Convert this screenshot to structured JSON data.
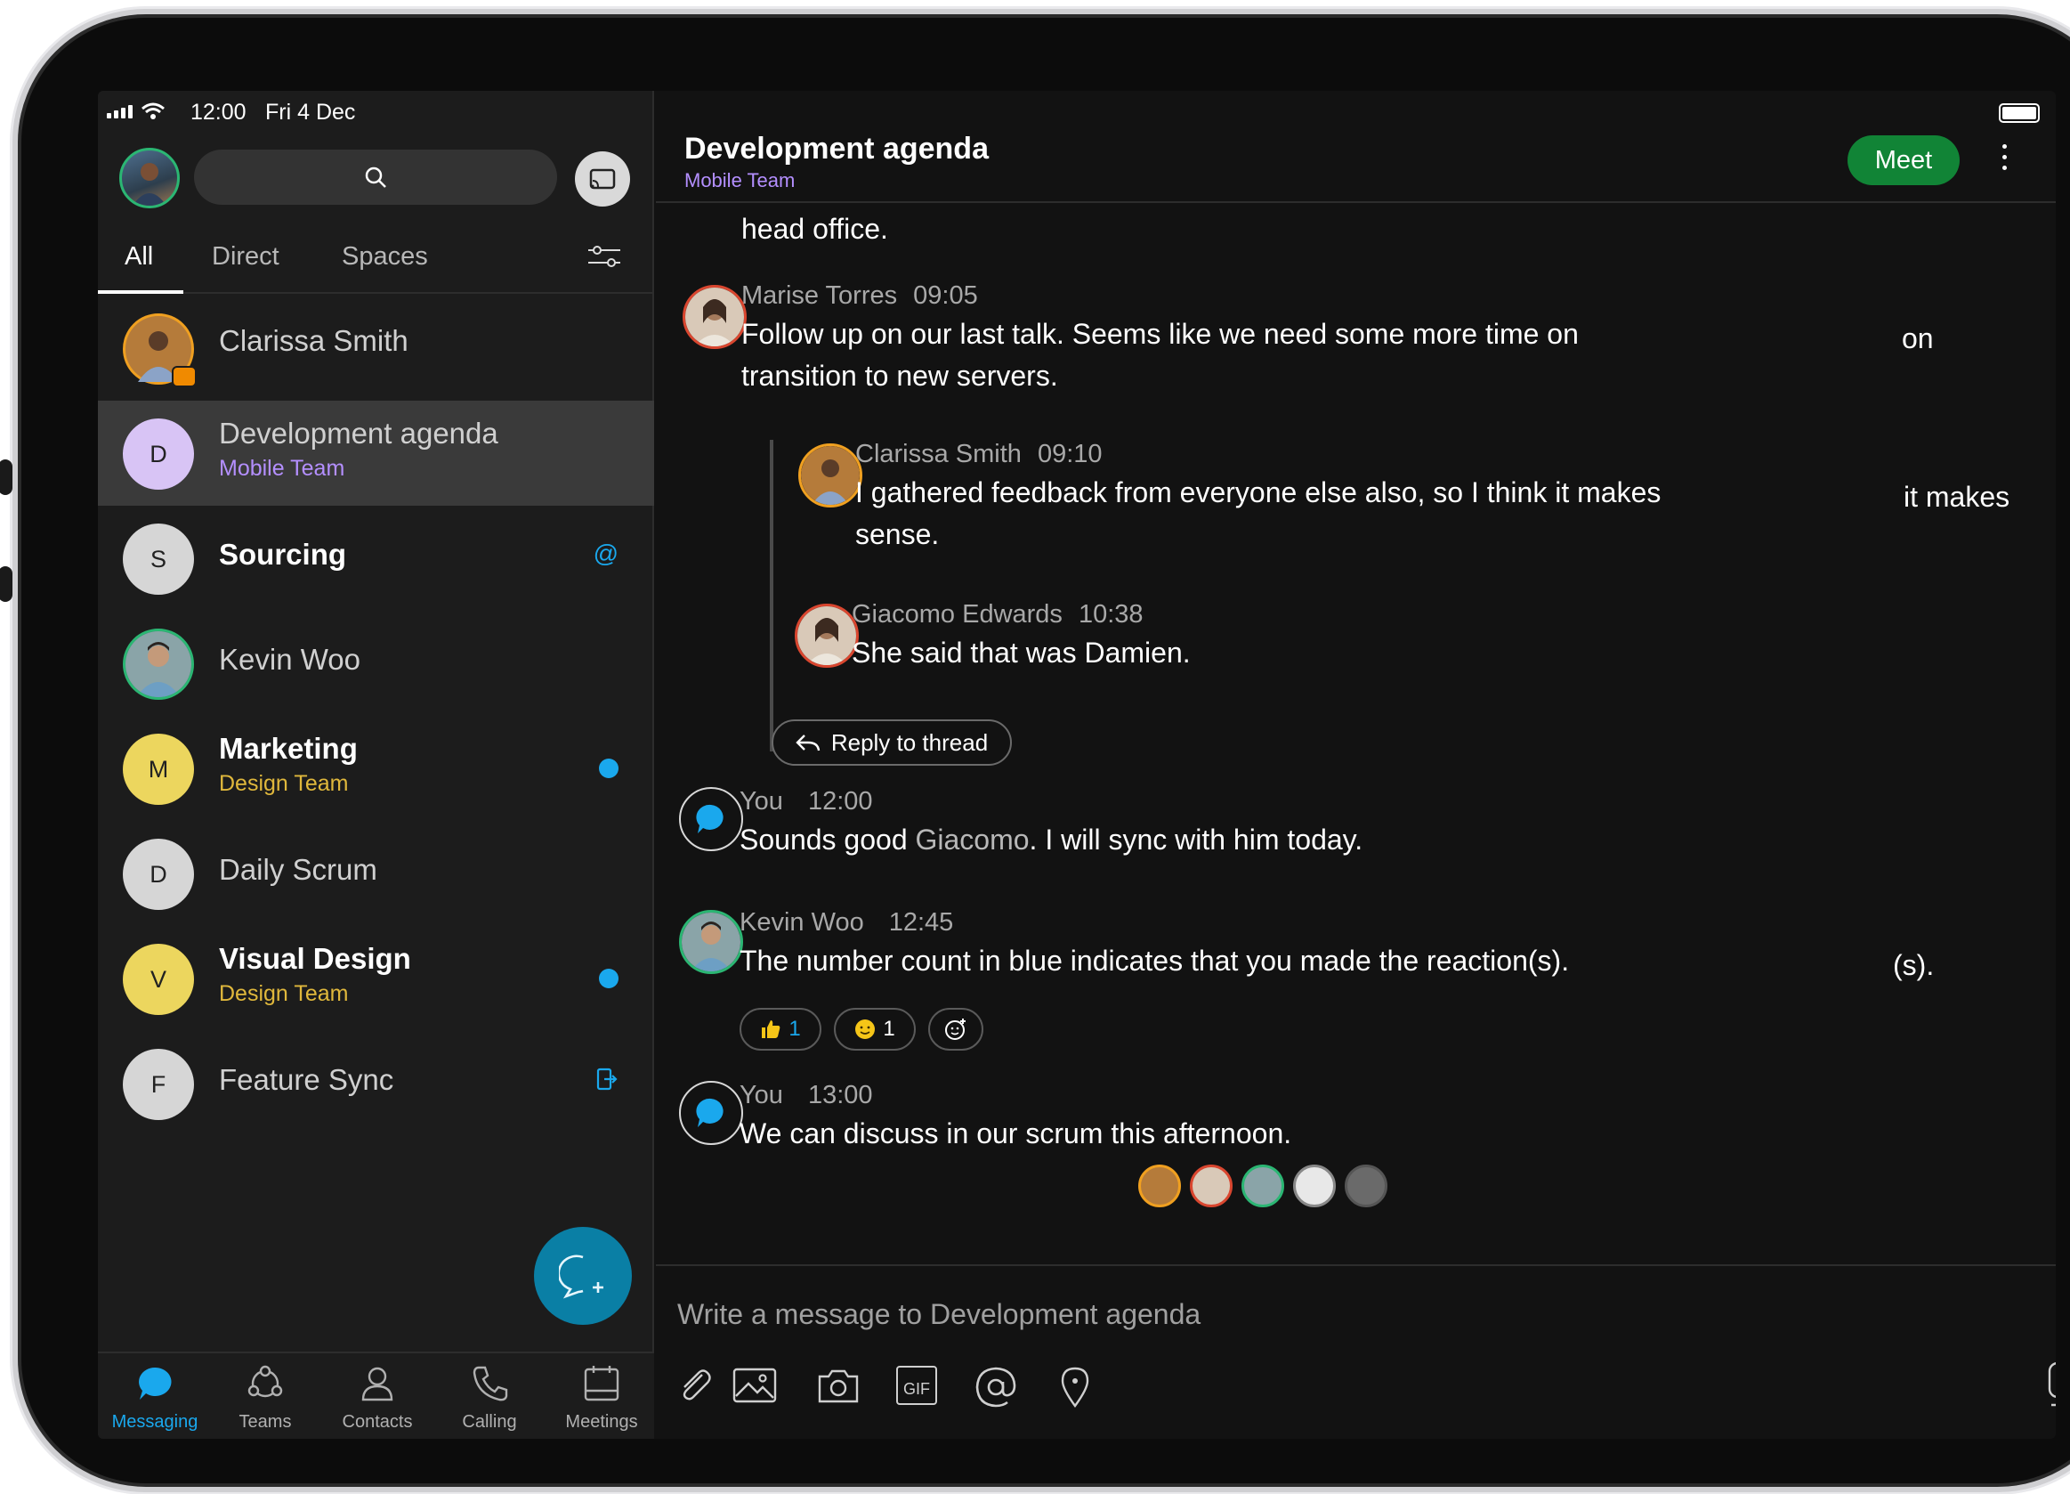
{
  "status_bar": {
    "time": "12:00",
    "date": "Fri 4 Dec"
  },
  "sidebar": {
    "tabs": [
      {
        "label": "All"
      },
      {
        "label": "Direct"
      },
      {
        "label": "Spaces"
      }
    ],
    "conversations": [
      {
        "title": "Clarissa Smith",
        "subtitle": "",
        "initial": ""
      },
      {
        "title": "Development agenda",
        "subtitle": "Mobile Team",
        "initial": "D"
      },
      {
        "title": "Sourcing",
        "subtitle": "",
        "initial": "S",
        "badge": "@"
      },
      {
        "title": "Kevin Woo",
        "subtitle": "",
        "initial": ""
      },
      {
        "title": "Marketing",
        "subtitle": "Design Team",
        "initial": "M"
      },
      {
        "title": "Daily Scrum",
        "subtitle": "",
        "initial": "D"
      },
      {
        "title": "Visual Design",
        "subtitle": "Design Team",
        "initial": "V"
      },
      {
        "title": "Feature Sync",
        "subtitle": "",
        "initial": "F"
      }
    ],
    "nav": [
      {
        "label": "Messaging"
      },
      {
        "label": "Teams"
      },
      {
        "label": "Contacts"
      },
      {
        "label": "Calling"
      },
      {
        "label": "Meetings"
      }
    ]
  },
  "chat": {
    "title": "Development agenda",
    "subtitle": "Mobile Team",
    "meet_label": "Meet",
    "partial_text": "head office.",
    "messages": [
      {
        "name": "Marise Torres",
        "time": "09:05",
        "text_line1": "Follow up on our last talk. Seems like we need some more time on",
        "text_line2": "transition to new servers.",
        "ghost": "on"
      },
      {
        "name": "Clarissa Smith",
        "time": "09:10",
        "text_line1": "I gathered feedback from everyone else also, so I think it makes",
        "text_line2": "sense.",
        "ghost": "it makes"
      },
      {
        "name": "Giacomo Edwards",
        "time": "10:38",
        "text_line1": "She said that was Damien."
      },
      {
        "name": "You",
        "time": "12:00",
        "text_pre": "Sounds good ",
        "mention": "Giacomo",
        "text_post": ". I will sync with him today."
      },
      {
        "name": "Kevin Woo",
        "time": "12:45",
        "text_line1": "The number count in blue indicates that you made the reaction(s).",
        "ghost": "(s)."
      },
      {
        "name": "You",
        "time": "13:00",
        "text_line1": "We can discuss in our scrum this afternoon."
      }
    ],
    "reply_to_thread": "Reply to thread",
    "reactions": [
      {
        "icon": "thumbs-up-icon",
        "count": "1",
        "count_color": "#1aa8ed"
      },
      {
        "icon": "smiley-icon",
        "count": "1",
        "count_color": "#ffffff"
      }
    ],
    "composer_placeholder": "Write a message to Development agenda",
    "composer_tools": [
      "paperclip-icon",
      "image-icon",
      "camera-icon",
      "gif-icon",
      "mention-icon",
      "location-icon"
    ],
    "gif_label": "GIF"
  },
  "colors": {
    "accent_blue": "#1aa8ed",
    "meet_green": "#118436",
    "team_purple": "#b48fff",
    "design_team_yellow": "#e0b83c"
  }
}
